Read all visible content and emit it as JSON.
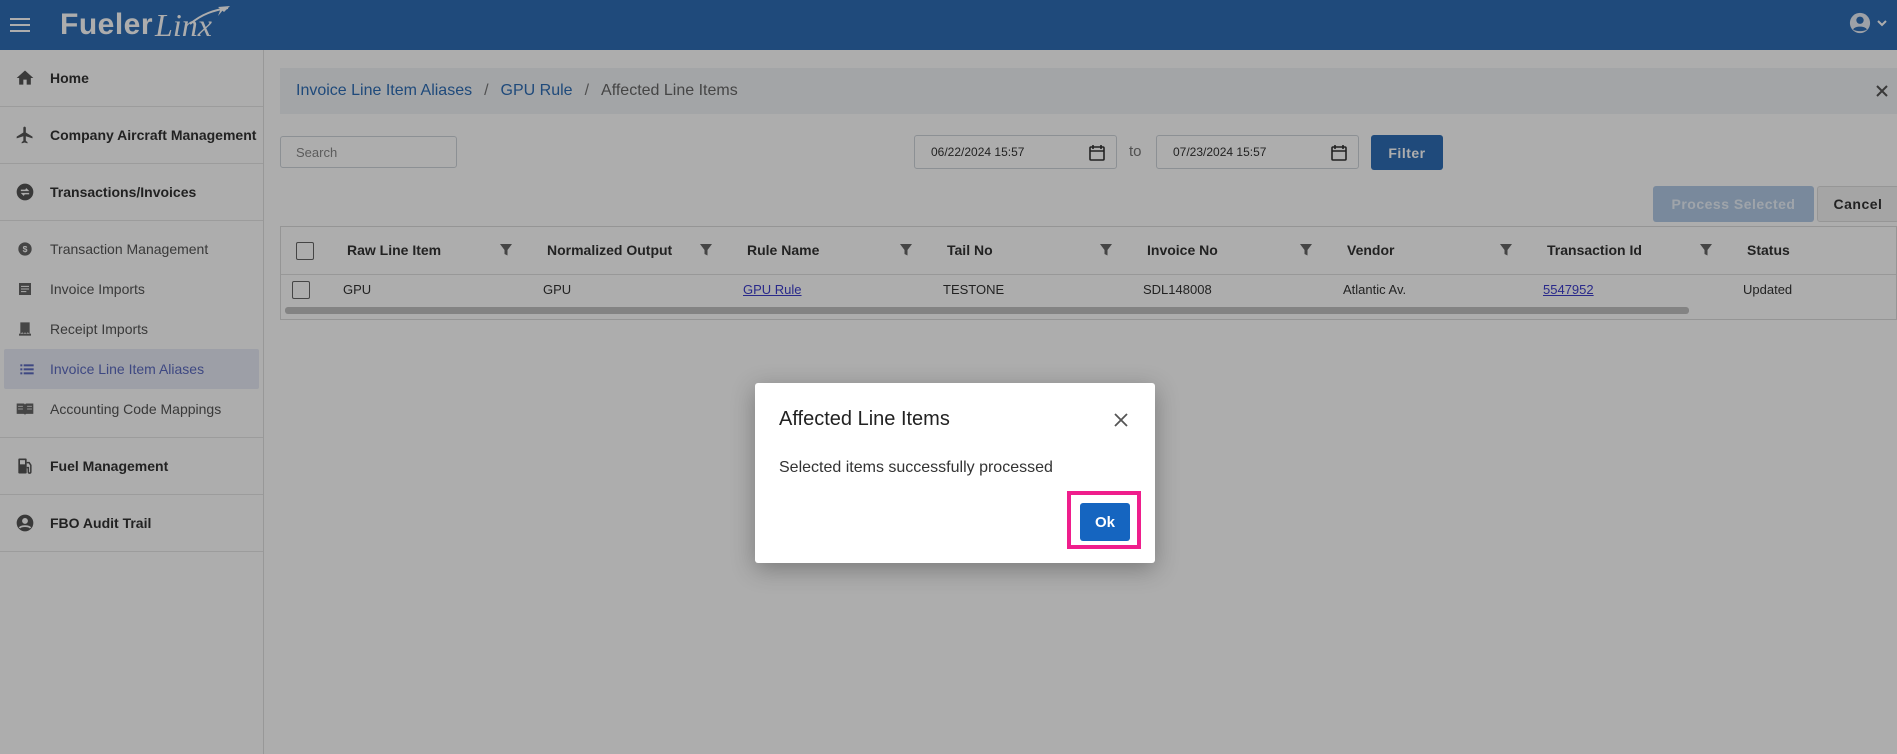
{
  "header": {
    "logo_text_1": "Fueler",
    "logo_text_2": "Linx"
  },
  "sidebar": {
    "items": [
      {
        "label": "Home",
        "icon": "home-icon"
      },
      {
        "label": "Company Aircraft Management",
        "icon": "airplane-icon"
      },
      {
        "label": "Transactions/Invoices",
        "icon": "swap-icon"
      }
    ],
    "sub_items": [
      {
        "label": "Transaction Management",
        "icon": "dollar-circle-icon"
      },
      {
        "label": "Invoice Imports",
        "icon": "invoice-icon"
      },
      {
        "label": "Receipt Imports",
        "icon": "receipt-icon"
      },
      {
        "label": "Invoice Line Item Aliases",
        "icon": "list-icon",
        "active": true
      },
      {
        "label": "Accounting Code Mappings",
        "icon": "book-icon"
      }
    ],
    "bottom_items": [
      {
        "label": "Fuel Management",
        "icon": "fuel-pump-icon"
      },
      {
        "label": "FBO Audit Trail",
        "icon": "account-circle-icon"
      }
    ]
  },
  "breadcrumb": {
    "items": [
      "Invoice Line Item Aliases",
      "GPU Rule"
    ],
    "current": "Affected Line Items",
    "separator": "/"
  },
  "filters": {
    "search_placeholder": "Search",
    "date_from": "06/22/2024 15:57",
    "to_label": "to",
    "date_to": "07/23/2024 15:57",
    "filter_label": "Filter"
  },
  "actions": {
    "process_label": "Process Selected",
    "cancel_label": "Cancel"
  },
  "grid": {
    "columns": [
      "Raw Line Item",
      "Normalized Output",
      "Rule Name",
      "Tail No",
      "Invoice No",
      "Vendor",
      "Transaction Id",
      "Status"
    ],
    "rows": [
      {
        "raw": "GPU",
        "normalized": "GPU",
        "rule": "GPU Rule",
        "tail": "TESTONE",
        "invoice": "SDL148008",
        "vendor": "Atlantic Av.",
        "transaction": "5547952",
        "status": "Updated"
      }
    ]
  },
  "dialog": {
    "title": "Affected Line Items",
    "message": "Selected items successfully processed",
    "ok_label": "Ok"
  },
  "colors": {
    "header": "#2f6eb5",
    "accent": "#1565c0",
    "highlight": "#ef1e8c"
  }
}
